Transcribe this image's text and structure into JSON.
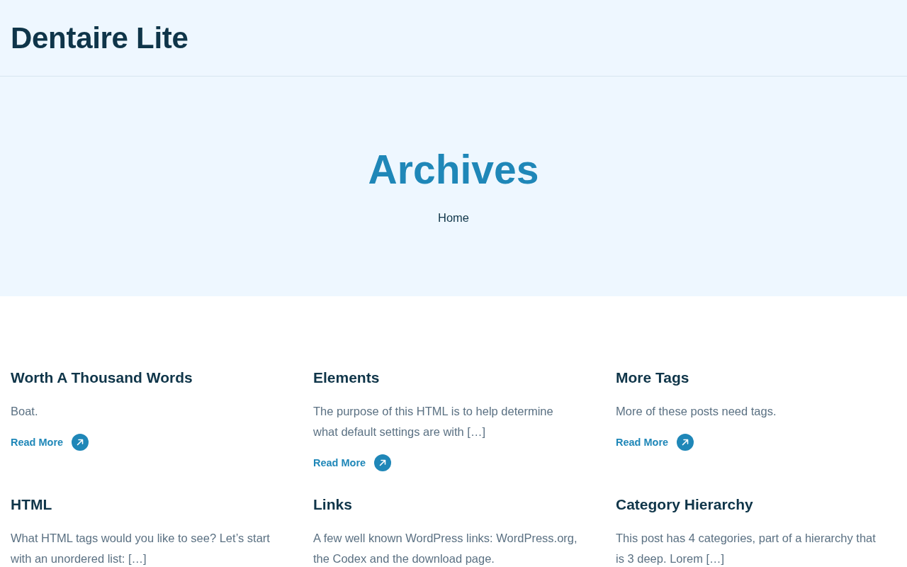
{
  "header": {
    "site_title": "Dentaire Lite"
  },
  "hero": {
    "title": "Archives",
    "breadcrumb": [
      "Home"
    ]
  },
  "posts": [
    {
      "title": "Worth A Thousand Words",
      "excerpt": "Boat.",
      "link": "Read More"
    },
    {
      "title": "Elements",
      "excerpt": "The purpose of this HTML is to help determine what default settings are with […]",
      "link": "Read More"
    },
    {
      "title": "More Tags",
      "excerpt": "More of these posts need tags.",
      "link": "Read More"
    },
    {
      "title": "HTML",
      "excerpt": "What HTML tags would you like to see? Let’s start with an unordered list: […]"
    },
    {
      "title": "Links",
      "excerpt": "A few well known WordPress links: WordPress.org, the Codex and the download page."
    },
    {
      "title": "Category Hierarchy",
      "excerpt": "This post has 4 categories, part of a hierarchy that is 3 deep. Lorem […]"
    }
  ]
}
